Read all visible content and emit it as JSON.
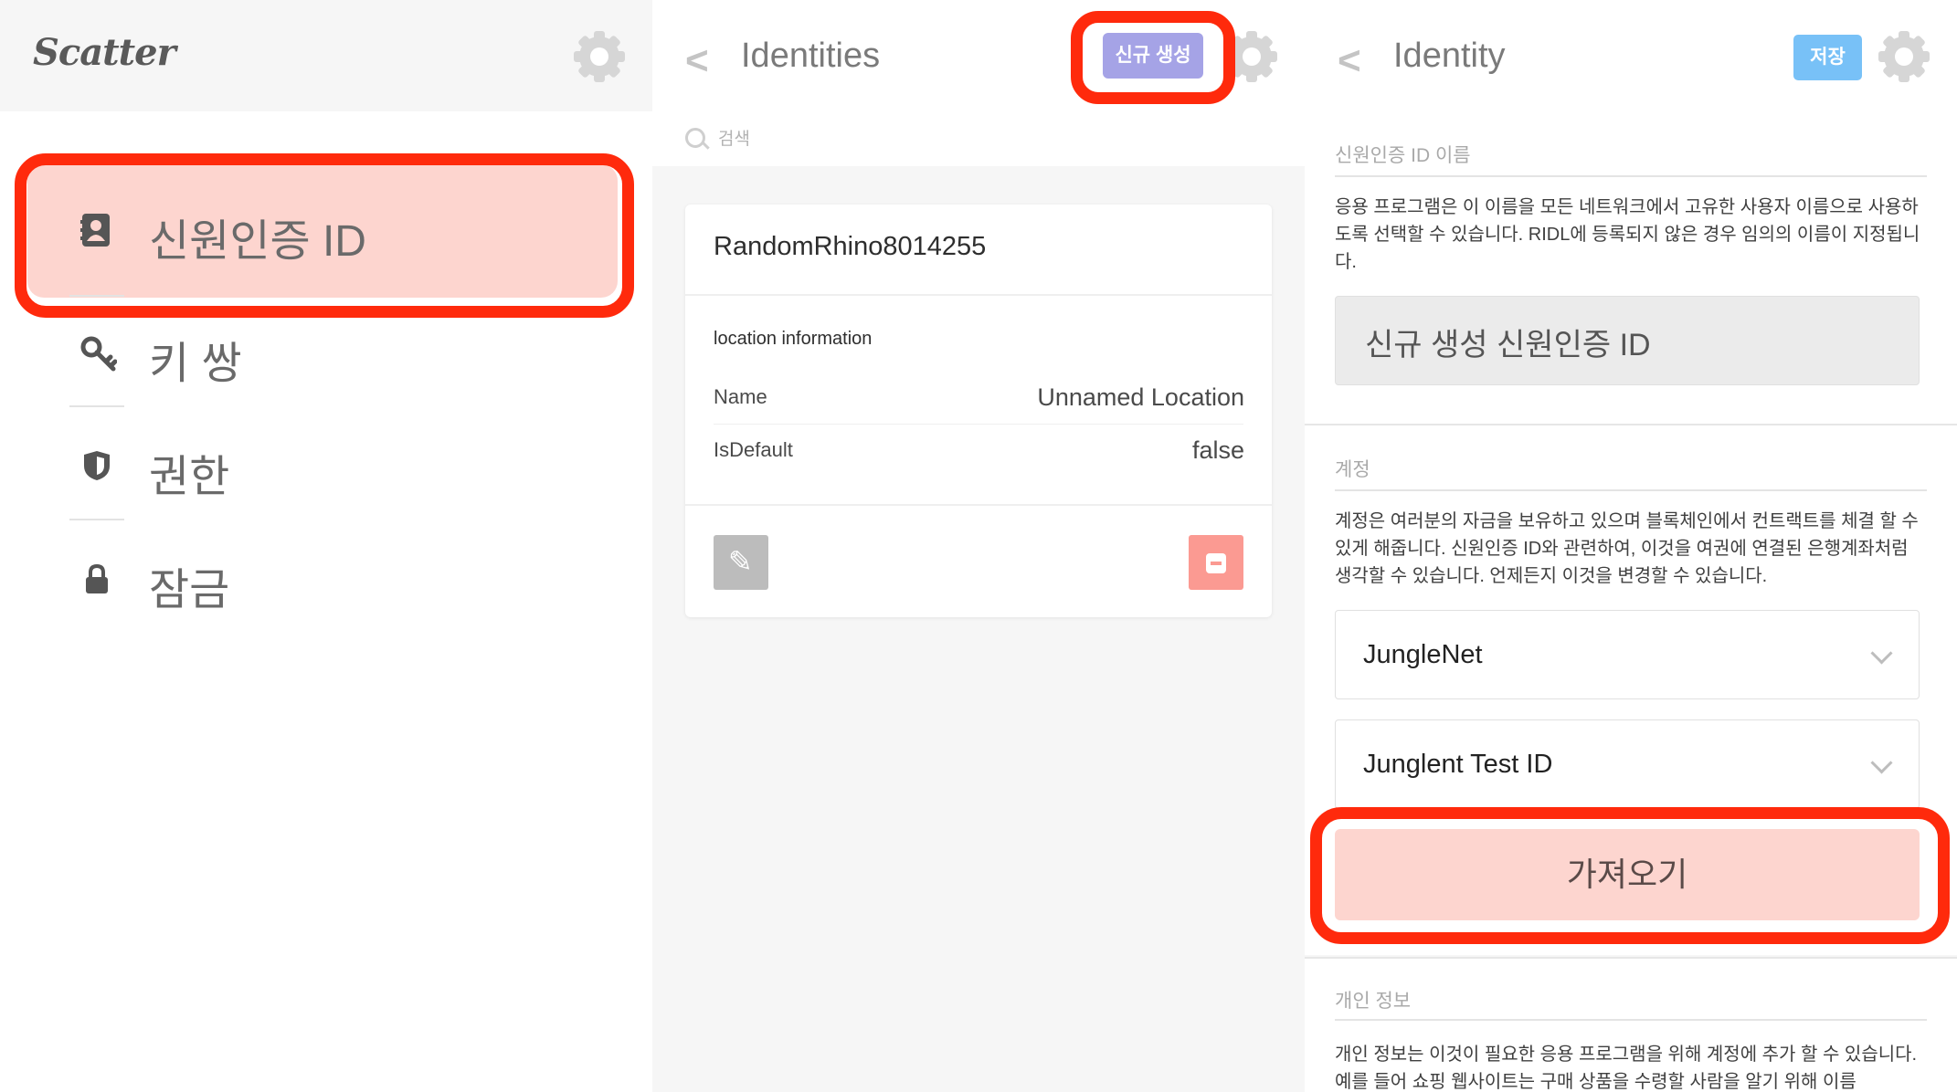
{
  "sidebar": {
    "logo": "Scatter",
    "items": [
      {
        "label": "신원인증 ID",
        "icon": "identity-card-icon",
        "active": true
      },
      {
        "label": "키 쌍",
        "icon": "key-icon"
      },
      {
        "label": "권한",
        "icon": "shield-icon"
      },
      {
        "label": "잠금",
        "icon": "lock-icon"
      }
    ]
  },
  "identities": {
    "title": "Identities",
    "new_button": "신규 생성",
    "search_placeholder": "검색",
    "card": {
      "name": "RandomRhino8014255",
      "section": "location information",
      "rows": [
        {
          "key": "Name",
          "value": "Unnamed Location"
        },
        {
          "key": "IsDefault",
          "value": "false"
        }
      ]
    }
  },
  "identity": {
    "title": "Identity",
    "save_button": "저장",
    "name_section": {
      "title": "신원인증 ID 이름",
      "description": "응용 프로그램은 이 이름을 모든 네트워크에서 고유한 사용자 이름으로 사용하도록 선택할 수 있습니다. RIDL에 등록되지 않은 경우 임의의 이름이 지정됩니다.",
      "input_value": "신규 생성 신원인증 ID"
    },
    "account_section": {
      "title": "계정",
      "description": "계정은 여러분의 자금을 보유하고 있으며 블록체인에서 컨트랙트를 체결 할 수 있게 해줍니다. 신원인증 ID와 관련하여, 이것을 여권에 연결된 은행계좌처럼 생각할 수 있습니다. 언제든지 이것을 변경할 수 있습니다.",
      "network_select": "JungleNet",
      "account_select": "Junglent Test ID",
      "import_button": "가져오기"
    },
    "personal_section": {
      "title": "개인 정보",
      "description": "개인 정보는 이것이 필요한 응용 프로그램을 위해 계정에 추가 할 수 있습니다. 예를 들어 쇼핑 웹사이트는 구매 상품을 수령할 사람을 알기 위해 이름"
    }
  },
  "colors": {
    "highlight": "#ff2a0c",
    "active_item_bg": "#fdd5cf",
    "new_button_bg": "#a5a3e6",
    "save_button_bg": "#78c1f7",
    "delete_button_bg": "#fb9a92"
  }
}
